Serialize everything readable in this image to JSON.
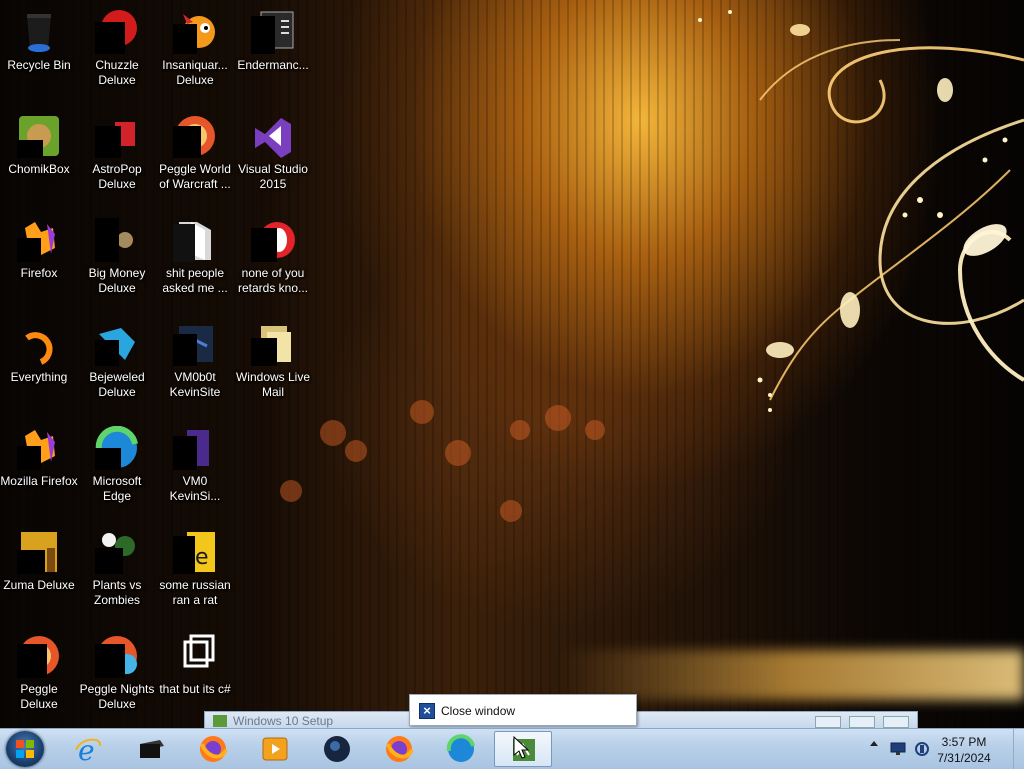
{
  "desktop": {
    "icons": [
      {
        "label": "Recycle Bin",
        "icon": "recycle-bin-icon"
      },
      {
        "label": "Chuzzle Deluxe",
        "icon": "chuzzle-icon"
      },
      {
        "label": "Insaniquar... Deluxe",
        "icon": "insaniquarium-icon"
      },
      {
        "label": "Endermanc...",
        "icon": "endermanch-icon"
      },
      {
        "label": "ChomikBox",
        "icon": "chomikbox-icon"
      },
      {
        "label": "AstroPop Deluxe",
        "icon": "astropop-icon"
      },
      {
        "label": "Peggle World of Warcraft ...",
        "icon": "peggle-wow-icon"
      },
      {
        "label": "Visual Studio 2015",
        "icon": "visual-studio-icon"
      },
      {
        "label": "Firefox",
        "icon": "firefox-icon"
      },
      {
        "label": "Big Money Deluxe",
        "icon": "big-money-icon"
      },
      {
        "label": "shit people asked me ...",
        "icon": "folder-icon"
      },
      {
        "label": "none of you retards kno...",
        "icon": "opera-icon"
      },
      {
        "label": "Everything",
        "icon": "everything-icon"
      },
      {
        "label": "Bejeweled Deluxe",
        "icon": "bejeweled-icon"
      },
      {
        "label": "VM0b0t KevinSite",
        "icon": "vm-file-icon"
      },
      {
        "label": "Windows Live Mail",
        "icon": "windows-live-mail-icon"
      },
      {
        "label": "Mozilla Firefox",
        "icon": "firefox-icon"
      },
      {
        "label": "Microsoft Edge",
        "icon": "edge-icon"
      },
      {
        "label": "VM0 KevinSi...",
        "icon": "vm-file-icon"
      },
      {
        "label": "Zuma Deluxe",
        "icon": "zuma-icon"
      },
      {
        "label": "Plants vs Zombies",
        "icon": "plants-vs-zombies-icon"
      },
      {
        "label": "some russian ran a rat",
        "icon": "rat-file-icon"
      },
      {
        "label": "Peggle Deluxe",
        "icon": "peggle-icon"
      },
      {
        "label": "Peggle Nights Deluxe",
        "icon": "peggle-nights-icon"
      },
      {
        "label": "that but its c#",
        "icon": "shortcut-icon"
      }
    ]
  },
  "window": {
    "title": "Windows 10 Setup"
  },
  "jump_list": {
    "close_label": "Close window"
  },
  "taskbar": {
    "pinned": [
      "internet-explorer-icon",
      "terminal-icon",
      "firefox-icon",
      "media-player-icon",
      "globe-icon",
      "firefox-icon",
      "edge-icon",
      "setup-icon"
    ],
    "tray": {
      "time": "3:57 PM",
      "date": "7/31/2024"
    }
  },
  "colors": {
    "taskbar": "#b7cfe8",
    "icon_label": "#ffffff",
    "jump_close": "#1f4f9a"
  }
}
